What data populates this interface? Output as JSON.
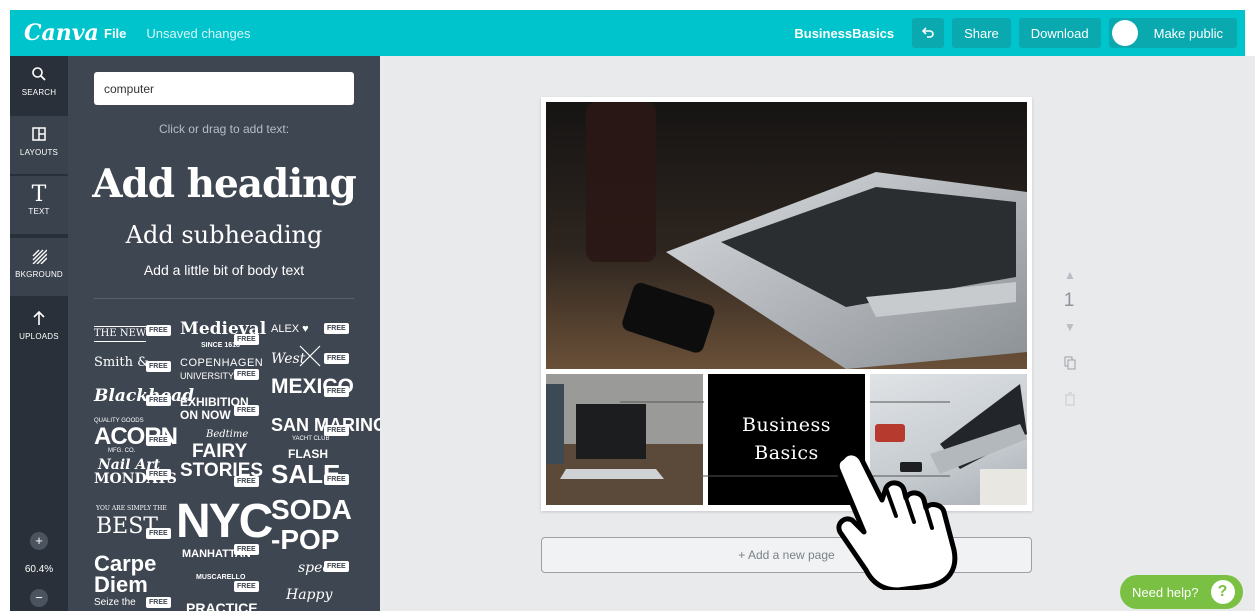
{
  "topbar": {
    "logo": "Canva",
    "file": "File",
    "status": "Unsaved changes",
    "design_title": "BusinessBasics",
    "share": "Share",
    "download": "Download",
    "make_public": "Make public",
    "undo_icon": "undo-icon"
  },
  "rail": {
    "items": [
      {
        "label": "SEARCH",
        "icon": "search-icon"
      },
      {
        "label": "LAYOUTS",
        "icon": "layouts-icon"
      },
      {
        "label": "TEXT",
        "icon": "text-icon"
      },
      {
        "label": "BKGROUND",
        "icon": "background-icon"
      },
      {
        "label": "UPLOADS",
        "icon": "upload-icon"
      }
    ],
    "zoom_in": "+",
    "zoom_level": "60.4%",
    "zoom_out": "−"
  },
  "panel": {
    "search_value": "computer",
    "hint": "Click or drag to add text:",
    "add_heading": "Add heading",
    "add_subheading": "Add subheading",
    "add_body": "Add a little bit of body text",
    "free_badge": "FREE",
    "templates": [
      "THE NEW",
      "Medieval",
      "SINCE 1618",
      "ALEX ♥",
      "Smith &",
      "COPENHAGEN",
      "UNIVERSITY",
      "West",
      "Blackhead",
      "EXHIBITION",
      "ON NOW",
      "MEXICO",
      "ACORN",
      "QUALITY GOODS",
      "MFG. CO.",
      "Bedtime",
      "FAIRY",
      "STORIES",
      "SAN MARINO",
      "YACHT CLUB",
      "FLASH",
      "SALE",
      "Nail Art",
      "MONDAYS",
      "YOU ARE SIMPLY THE",
      "BEST",
      "NYC",
      "MANHATTAN",
      "SODA",
      "-POP",
      "special",
      "Carpe",
      "Diem",
      "Seize the",
      "MUSCARELLO",
      "PRACTICE",
      "Happy"
    ]
  },
  "design": {
    "tile_line1": "Business",
    "tile_line2": "Basics",
    "page_number": "1",
    "add_page": "+ Add a new page"
  },
  "help": {
    "label": "Need help?",
    "q": "?"
  }
}
